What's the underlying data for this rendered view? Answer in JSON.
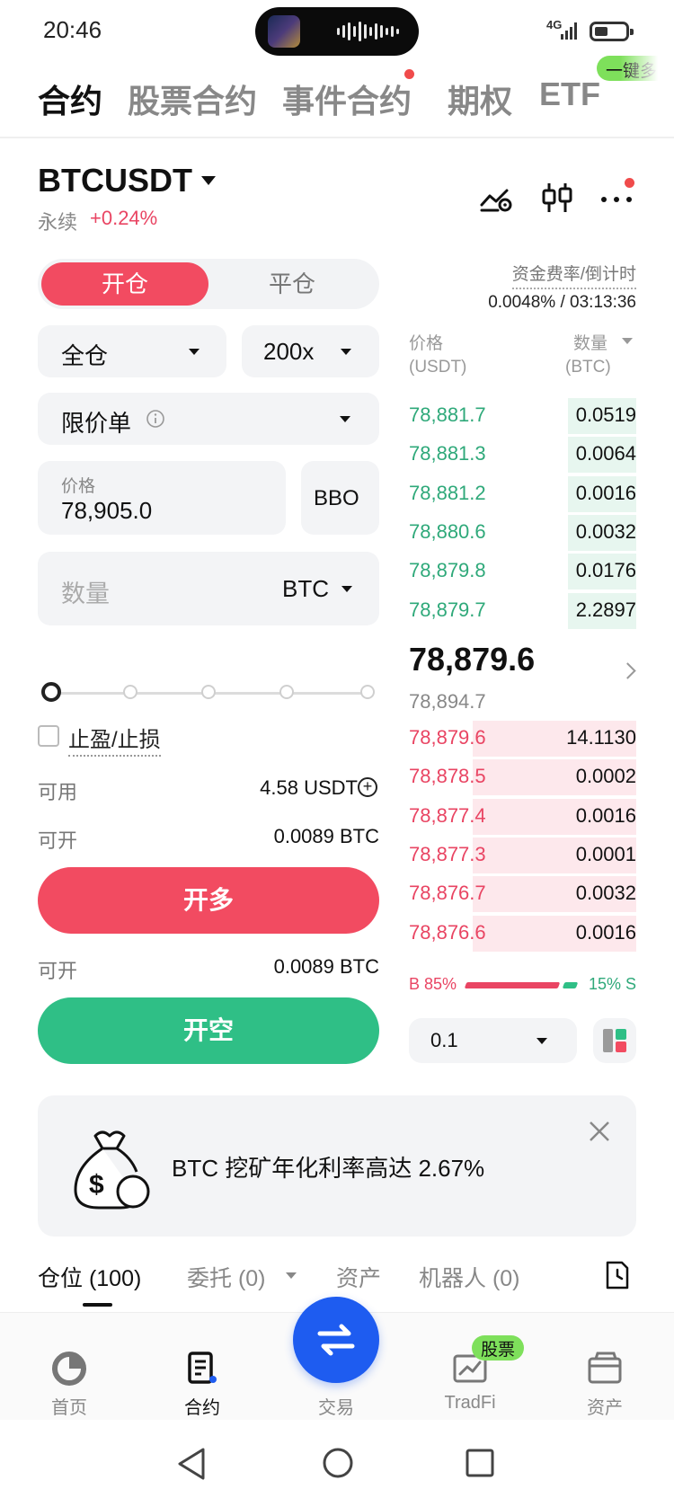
{
  "status_bar": {
    "time": "20:46",
    "network": "4G"
  },
  "top_tabs": [
    {
      "label": "合约",
      "active": true
    },
    {
      "label": "股票合约",
      "active": false
    },
    {
      "label": "事件合约",
      "active": false,
      "dot": true
    },
    {
      "label": "期权",
      "active": false
    },
    {
      "label": "ETF",
      "active": false
    }
  ],
  "promo_pill": "一键多空",
  "pair": {
    "symbol": "BTCUSDT",
    "type": "永续",
    "change": "+0.24%"
  },
  "header_icons": [
    "price-alert-icon",
    "candlestick-chart-icon",
    "more-dots-icon"
  ],
  "position_toggle": {
    "open": "开仓",
    "close": "平仓"
  },
  "margin_mode": "全仓",
  "leverage": "200x",
  "order_type": "限价单",
  "price_field": {
    "label": "价格",
    "value": "78,905.0",
    "bbo": "BBO"
  },
  "quantity_field": {
    "placeholder": "数量",
    "unit": "BTC"
  },
  "slider": {
    "value_fraction": 0
  },
  "tpsl_label": "止盈/止损",
  "available": {
    "label": "可用",
    "value": "4.58 USDT"
  },
  "can_open_long": {
    "label": "可开",
    "value": "0.0089 BTC"
  },
  "buy_button": "开多",
  "can_open_short": {
    "label": "可开",
    "value": "0.0089 BTC"
  },
  "sell_button": "开空",
  "funding": {
    "label": "资金费率/倒计时",
    "value": "0.0048% / 03:13:36"
  },
  "orderbook": {
    "price_header": "价格",
    "price_unit": "(USDT)",
    "qty_header": "数量",
    "qty_unit": "(BTC)",
    "asks": [
      {
        "price": "78,881.7",
        "qty": "0.0519",
        "depth": 0.3
      },
      {
        "price": "78,881.3",
        "qty": "0.0064",
        "depth": 0.3
      },
      {
        "price": "78,881.2",
        "qty": "0.0016",
        "depth": 0.3
      },
      {
        "price": "78,880.6",
        "qty": "0.0032",
        "depth": 0.3
      },
      {
        "price": "78,879.8",
        "qty": "0.0176",
        "depth": 0.3
      },
      {
        "price": "78,879.7",
        "qty": "2.2897",
        "depth": 0.3
      }
    ],
    "last_price": "78,879.6",
    "mark_price": "78,894.7",
    "bids": [
      {
        "price": "78,879.6",
        "qty": "14.1130",
        "depth": 0.72
      },
      {
        "price": "78,878.5",
        "qty": "0.0002",
        "depth": 0.72
      },
      {
        "price": "78,877.4",
        "qty": "0.0016",
        "depth": 0.72
      },
      {
        "price": "78,877.3",
        "qty": "0.0001",
        "depth": 0.72
      },
      {
        "price": "78,876.7",
        "qty": "0.0032",
        "depth": 0.72
      },
      {
        "price": "78,876.6",
        "qty": "0.0016",
        "depth": 0.72
      }
    ],
    "buy_ratio": "B 85%",
    "sell_ratio": "15% S",
    "step": "0.1"
  },
  "banner": {
    "text": "BTC 挖矿年化利率高达 2.67%"
  },
  "bottom_tabs": [
    {
      "label": "仓位 (100)",
      "active": true
    },
    {
      "label": "委托 (0)",
      "active": false
    },
    {
      "label": "资产",
      "active": false
    },
    {
      "label": "机器人 (0)",
      "active": false
    }
  ],
  "bottom_nav": [
    {
      "label": "首页",
      "icon": "home-icon",
      "active": false
    },
    {
      "label": "合约",
      "icon": "contract-icon",
      "active": true
    },
    {
      "label": "交易",
      "icon": "swap-icon",
      "active": false
    },
    {
      "label": "TradFi",
      "icon": "tradfi-icon",
      "active": false
    },
    {
      "label": "资产",
      "icon": "wallet-icon",
      "active": false
    }
  ],
  "tradfi_badge": "股票",
  "colors": {
    "buy": "#f24b61",
    "sell": "#2fbf86",
    "accent_blue": "#1e5cf0",
    "promo": "#7ee05b"
  }
}
